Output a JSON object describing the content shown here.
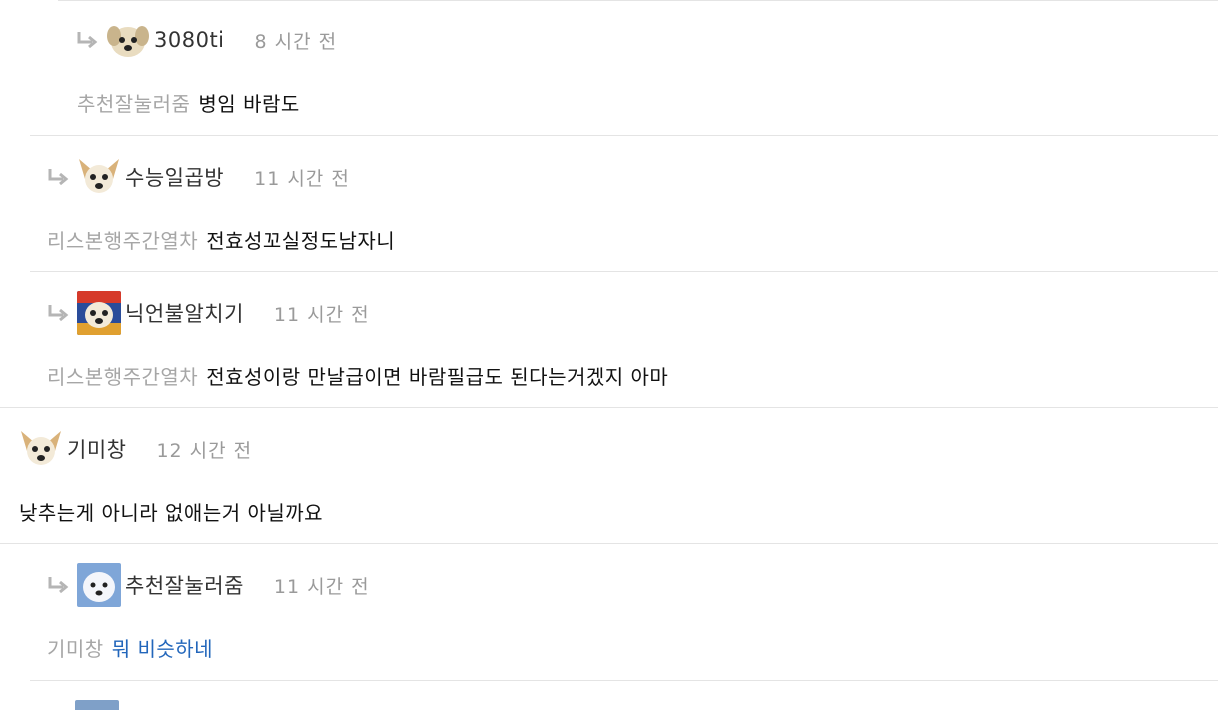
{
  "comments": [
    {
      "nickname": "3080ti",
      "time": "8 시간 전",
      "mention": "추천잘눌러줌",
      "text": "병임 바람도",
      "avatar": "white-puppy-avatar",
      "reply_icon": "reply-arrow-icon"
    },
    {
      "nickname": "수능일곱방",
      "time": "11 시간 전",
      "mention": "리스본행주간열차",
      "text": "전효성꼬실정도남자니",
      "avatar": "chihuahua-avatar",
      "reply_icon": "reply-arrow-icon"
    },
    {
      "nickname": "닉언불알치기",
      "time": "11 시간 전",
      "mention": "리스본행주간열차",
      "text": "전효성이랑 만날급이면 바람필급도 된다는거겠지 아마",
      "avatar": "colorful-dog-avatar",
      "reply_icon": "reply-arrow-icon"
    },
    {
      "nickname": "기미창",
      "time": "12 시간 전",
      "mention": "",
      "text": "낮추는게 아니라 없애는거 아닐까요",
      "avatar": "chihuahua-avatar"
    },
    {
      "nickname": "추천잘눌러줌",
      "time": "11 시간 전",
      "mention": "기미창",
      "text": "뭐 비슷하네",
      "avatar": "samoyed-avatar",
      "reply_icon": "reply-arrow-icon",
      "text_color": "#2266bb"
    }
  ]
}
